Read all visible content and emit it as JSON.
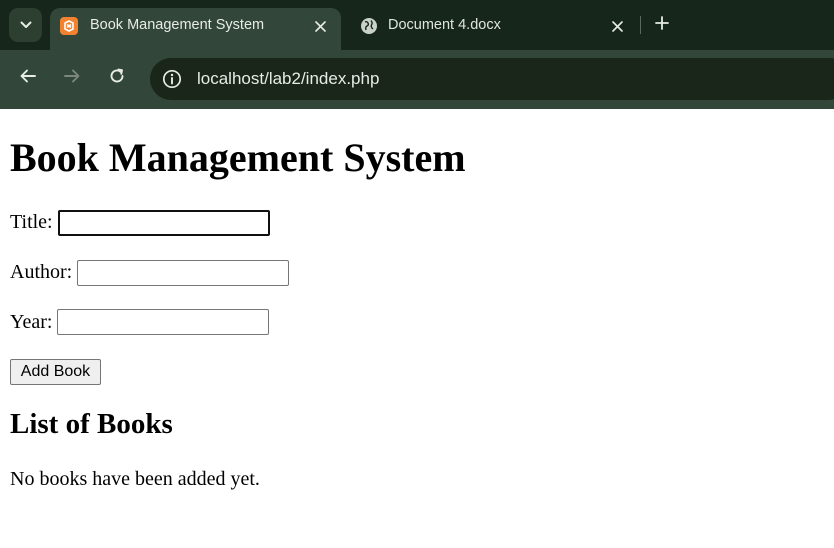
{
  "browser": {
    "tabs": [
      {
        "title": "Book Management System",
        "active": true,
        "favicon": "xampp-icon"
      },
      {
        "title": "Document 4.docx",
        "active": false,
        "favicon": "globe-icon"
      }
    ],
    "url": "localhost/lab2/index.php",
    "colors": {
      "tabstrip": "#17261a",
      "toolbar": "#33463a",
      "omnibox": "#192619",
      "favicon_accent": "#f28230"
    }
  },
  "page": {
    "heading": "Book Management System",
    "form": {
      "title_label": "Title:",
      "title_value": "",
      "author_label": "Author:",
      "author_value": "",
      "year_label": "Year:",
      "year_value": "",
      "submit_label": "Add Book"
    },
    "list_heading": "List of Books",
    "empty_message": "No books have been added yet."
  }
}
